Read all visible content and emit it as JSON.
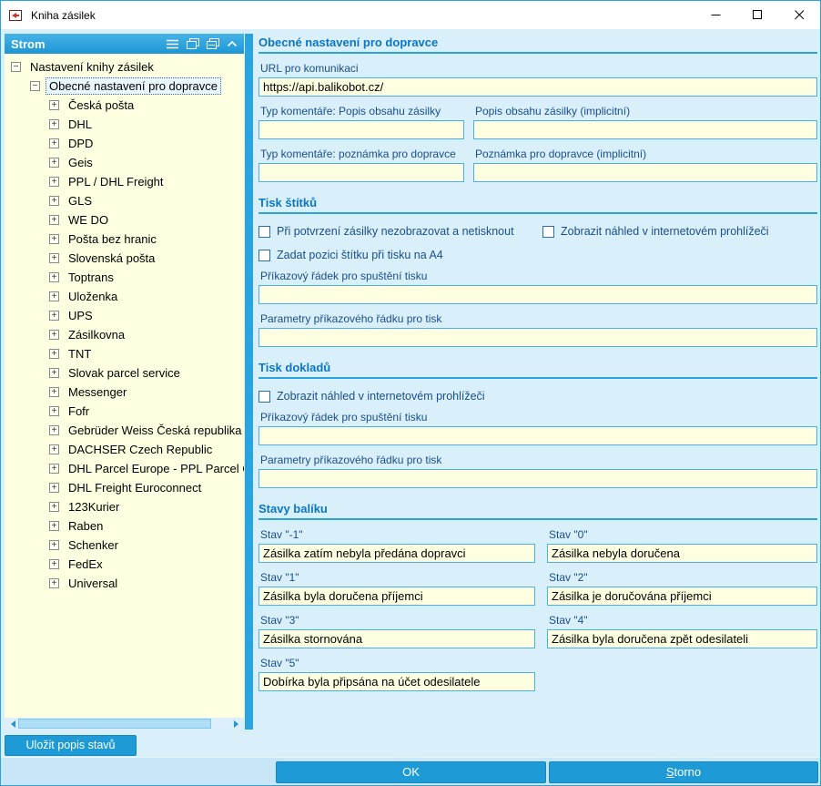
{
  "window": {
    "title": "Kniha zásilek"
  },
  "colors": {
    "accent_blue": "#1E9BD7",
    "header_blue": "#2AA4DF",
    "panel_background": "#D9F0FB",
    "field_background": "#FFFFE1",
    "section_title": "#0B76C4",
    "label_text": "#1A4E8A"
  },
  "icons": {
    "app_icon": "red-parcel-logo",
    "minimize_icon": "horizontal-line",
    "maximize_icon": "square-outline",
    "close_icon": "x-cross",
    "menu_icon": "three-lines",
    "expand_all_icon": "stacked-windows",
    "collapse_all_icon": "stacked-windows-filled",
    "collapse_panel_icon": "chevron-up",
    "tree_collapse_icon": "minus-box",
    "tree_expand_icon": "plus-box",
    "scroll_left_icon": "triangle-left",
    "scroll_right_icon": "triangle-right"
  },
  "tree_panel": {
    "header": "Strom",
    "root": "Nastavení knihy zásilek",
    "selected": "Obecné nastavení pro dopravce",
    "carriers": [
      "Česká pošta",
      "DHL",
      "DPD",
      "Geis",
      "PPL / DHL Freight",
      "GLS",
      "WE DO",
      "Pošta bez hranic",
      "Slovenská pošta",
      "Toptrans",
      "Uloženka",
      "UPS",
      "Zásilkovna",
      "TNT",
      "Slovak parcel service",
      "Messenger",
      "Fofr",
      "Gebrüder Weiss Česká republika",
      "DACHSER Czech Republic",
      "DHL Parcel Europe - PPL Parcel Co",
      "DHL Freight Euroconnect",
      "123Kurier",
      "Raben",
      "Schenker",
      "FedEx",
      "Universal"
    ],
    "save_states_button": "Uložit popis stavů"
  },
  "general": {
    "title": "Obecné nastavení pro dopravce",
    "url_label": "URL pro komunikaci",
    "url_value": "https://api.balikobot.cz/",
    "comment_content_label": "Typ komentáře: Popis obsahu zásilky",
    "content_implicit_label": "Popis obsahu zásilky (implicitní)",
    "comment_note_label": "Typ komentáře: poznámka pro dopravce",
    "note_implicit_label": "Poznámka pro dopravce (implicitní)"
  },
  "labels_print": {
    "title": "Tisk štítků",
    "checkbox_no_print": "Při potvrzení zásilky nezobrazovat a netisknout",
    "checkbox_preview": "Zobrazit náhled v internetovém prohlížeči",
    "checkbox_position": "Zadat pozici štítku při tisku na A4",
    "command_label": "Příkazový řádek pro spuštění tisku",
    "params_label": "Parametry příkazového řádku pro tisk"
  },
  "docs_print": {
    "title": "Tisk dokladů",
    "checkbox_preview": "Zobrazit náhled v internetovém prohlížeči",
    "command_label": "Příkazový řádek pro spuštění tisku",
    "params_label": "Parametry příkazového řádku pro tisk"
  },
  "states": {
    "title": "Stavy balíku",
    "items": [
      {
        "label": "Stav \"-1\"",
        "value": "Zásilka zatím nebyla předána dopravci"
      },
      {
        "label": "Stav \"0\"",
        "value": "Zásilka nebyla doručena"
      },
      {
        "label": "Stav \"1\"",
        "value": "Zásilka byla doručena příjemci"
      },
      {
        "label": "Stav \"2\"",
        "value": "Zásilka je doručována příjemci"
      },
      {
        "label": "Stav \"3\"",
        "value": "Zásilka stornována"
      },
      {
        "label": "Stav \"4\"",
        "value": "Zásilka byla doručena zpět odesilateli"
      },
      {
        "label": "Stav \"5\"",
        "value": "Dobírka byla připsána na účet odesilatele"
      }
    ]
  },
  "footer": {
    "ok": "OK",
    "cancel": "Storno"
  }
}
